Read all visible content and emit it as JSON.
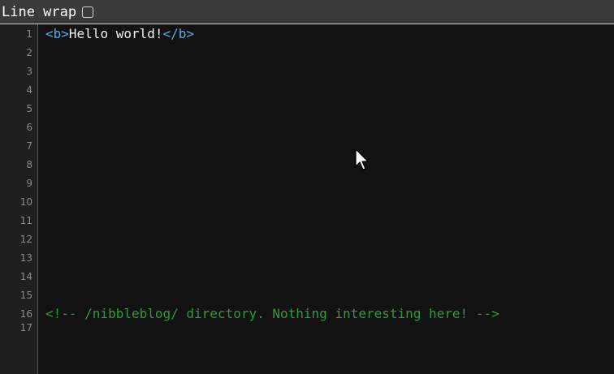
{
  "toolbar": {
    "line_wrap_label": "Line wrap",
    "line_wrap_checked": false
  },
  "gutter": {
    "line_numbers": [
      "1",
      "2",
      "3",
      "4",
      "5",
      "6",
      "7",
      "8",
      "9",
      "10",
      "11",
      "12",
      "13",
      "14",
      "15",
      "16",
      "17"
    ]
  },
  "editor": {
    "line1": {
      "open_tag": "<b>",
      "text": "Hello world!",
      "close_tag": "</b>"
    },
    "line16": {
      "comment": "<!-- /nibbleblog/ directory. Nothing interesting here! -->"
    }
  },
  "colors": {
    "tag": "#5aaee0",
    "text": "#f2f2f2",
    "comment": "#2f9a3a",
    "background": "#121212",
    "gutter": "#1f1f1f",
    "toolbar": "#3a3a3a"
  },
  "icons": {
    "mouse_cursor": "mouse-pointer-icon"
  }
}
